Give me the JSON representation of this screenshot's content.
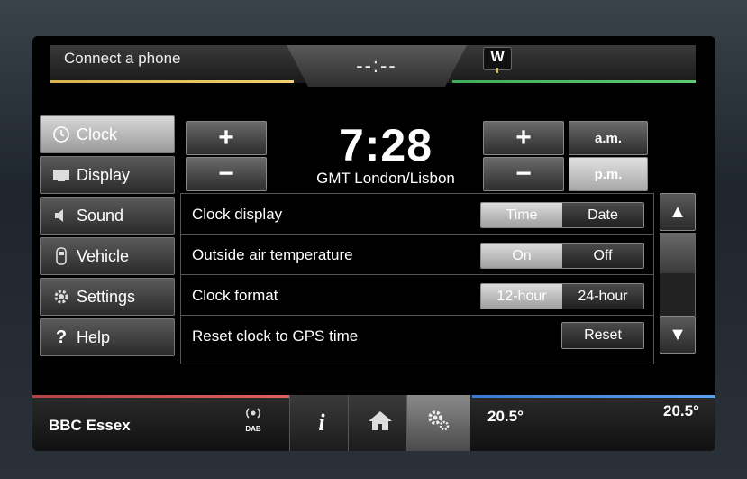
{
  "top": {
    "phone_status": "Connect a phone",
    "time_placeholder": "--:--",
    "compass": "W"
  },
  "nav": {
    "items": [
      {
        "label": "Clock",
        "icon": "clock-icon",
        "active": true
      },
      {
        "label": "Display",
        "icon": "display-icon",
        "active": false
      },
      {
        "label": "Sound",
        "icon": "speaker-icon",
        "active": false
      },
      {
        "label": "Vehicle",
        "icon": "car-icon",
        "active": false
      },
      {
        "label": "Settings",
        "icon": "gear-icon",
        "active": false
      },
      {
        "label": "Help",
        "icon": "question-icon",
        "active": false
      }
    ]
  },
  "clock": {
    "time": "7:28",
    "zone": "GMT London/Lisbon",
    "plus": "+",
    "minus": "−",
    "am": "a.m.",
    "pm": "p.m.",
    "selected_period": "p.m."
  },
  "settings": {
    "rows": [
      {
        "label": "Clock display",
        "options": [
          "Time",
          "Date"
        ],
        "selected": "Time"
      },
      {
        "label": "Outside air temperature",
        "options": [
          "On",
          "Off"
        ],
        "selected": "On"
      },
      {
        "label": "Clock format",
        "options": [
          "12-hour",
          "24-hour"
        ],
        "selected": "12-hour"
      },
      {
        "label": "Reset clock to GPS time",
        "button": "Reset"
      }
    ]
  },
  "scroll": {
    "up": "▲",
    "down": "▼"
  },
  "bottom": {
    "radio_station": "BBC Essex",
    "dab_label": "DAB",
    "info_glyph": "i",
    "temp_left": "20.5°",
    "temp_right": "20.5°"
  },
  "colors": {
    "accent_gold": "#d8b24a",
    "accent_green": "#3fae5a",
    "accent_red": "#d05050",
    "accent_blue": "#4a8ee0"
  }
}
